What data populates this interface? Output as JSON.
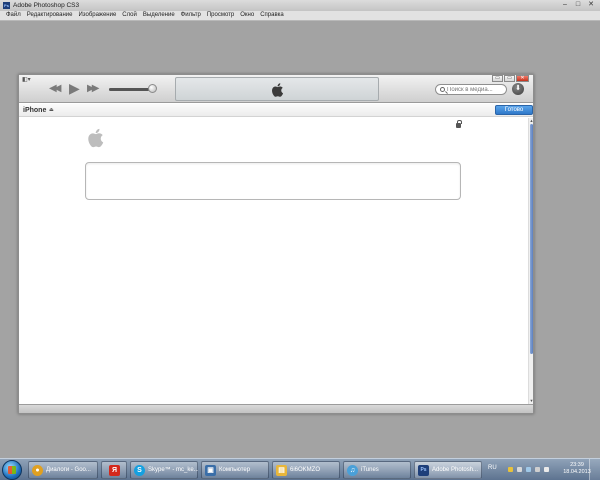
{
  "photoshop": {
    "title": "Adobe Photoshop CS3",
    "logo": "Ps",
    "controls": {
      "minimize": "–",
      "maximize": "□",
      "close": "✕"
    },
    "menu": [
      "Файл",
      "Редактирование",
      "Изображение",
      "Слой",
      "Выделение",
      "Фильтр",
      "Просмотр",
      "Окно",
      "Справка"
    ]
  },
  "itunes": {
    "menu_toggle": "◧▾",
    "controls": {
      "prev": "◀◀",
      "play": "▶",
      "next": "▶▶"
    },
    "volume": 0.9,
    "mini_buttons": {
      "mini": "▭",
      "max": "▭",
      "close": "✕"
    },
    "search_placeholder": "Поиск в медиа...",
    "download_icon": "⬇",
    "device_name": "iPhone",
    "eject": "⏏",
    "done_label": "Готово",
    "scroll_up": "▲",
    "scroll_down": "▼",
    "icons": {
      "lcd_logo": "apple-icon",
      "content_logo": "apple-icon",
      "secure": "lock-icon"
    }
  },
  "taskbar": {
    "apps": [
      {
        "name": "chrome",
        "label": "Диалоги - Goo...",
        "icon": "●",
        "color": "#e0a020"
      },
      {
        "name": "yandex",
        "label": "",
        "icon": "Я",
        "color": "#d4281c"
      },
      {
        "name": "skype",
        "label": "Skype™ - mc_ke...",
        "icon": "S",
        "color": "#14a0e0"
      },
      {
        "name": "computer",
        "label": "Компьютер",
        "icon": "▣",
        "color": "#3a6ea8"
      },
      {
        "name": "folder",
        "label": "6i6OKMZO",
        "icon": "▤",
        "color": "#e8b63a"
      },
      {
        "name": "itunes",
        "label": "iTunes",
        "icon": "♫",
        "color": "#4aa0d8"
      },
      {
        "name": "photoshop",
        "label": "Adobe Photosh...",
        "icon": "Ps",
        "color": "#1e3f7a"
      }
    ],
    "tray": {
      "lang": "RU",
      "time": "23:39",
      "date": "18.04.2013"
    },
    "colors": {
      "accent_start": "#1e6fbd"
    }
  }
}
